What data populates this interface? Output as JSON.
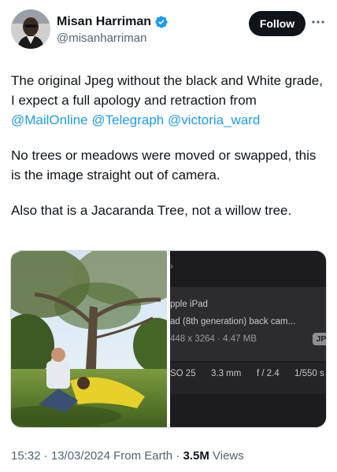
{
  "author": {
    "name": "Misan Harriman",
    "handle": "@misanharriman",
    "verified": true,
    "avatar_icon": "avatar-portrait"
  },
  "actions": {
    "follow_label": "Follow",
    "more_icon": "more-horizontal-icon"
  },
  "tweet": {
    "line1": "The original Jpeg without the black and White grade, I expect a full apology and retraction from",
    "mentions": [
      "@MailOnline",
      "@Telegraph",
      "@victoria_ward"
    ],
    "para2": "No trees or meadows were moved or swapped, this is the image straight out of camera.",
    "para3": "Also that is a Jacaranda Tree, not a willow tree."
  },
  "media_info": {
    "row0": "›",
    "device": "pple iPad",
    "camera": "ad (8th generation) back cam...",
    "resolution": "448 x 3264",
    "separator": "·",
    "size": "4.47 MB",
    "format_badge": "JPG",
    "iso": "SO 25",
    "focal": "3.3 mm",
    "aperture": "f / 2.4",
    "shutter": "1/550 s"
  },
  "meta": {
    "time_date": "15:32 · 13/03/2024 From Earth ·",
    "views_count": "3.5M",
    "views_label": "Views"
  },
  "colors": {
    "link": "#1d9bf0",
    "text": "#0f1419",
    "muted": "#536471",
    "verified": "#1d9bf0"
  }
}
